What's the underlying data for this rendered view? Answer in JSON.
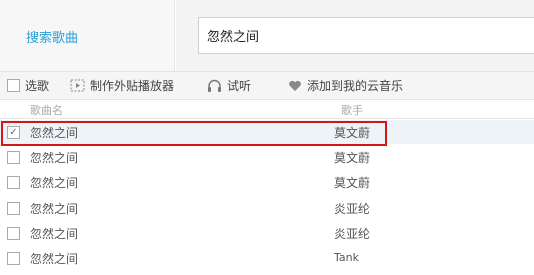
{
  "nav": {
    "search_songs": "搜索歌曲"
  },
  "search": {
    "value": "忽然之间"
  },
  "toolbar": {
    "select_all": "选歌",
    "make_player": "制作外贴播放器",
    "listen": "试听",
    "add_cloud": "添加到我的云音乐"
  },
  "columns": {
    "song": "歌曲名",
    "artist": "歌手"
  },
  "rows": [
    {
      "song": "忽然之间",
      "artist": "莫文蔚",
      "checked": true
    },
    {
      "song": "忽然之间",
      "artist": "莫文蔚",
      "checked": false
    },
    {
      "song": "忽然之间",
      "artist": "莫文蔚",
      "checked": false
    },
    {
      "song": "忽然之间",
      "artist": "炎亚纶",
      "checked": false
    },
    {
      "song": "忽然之间",
      "artist": "炎亚纶",
      "checked": false
    },
    {
      "song": "忽然之间",
      "artist": "Tank",
      "checked": false
    }
  ],
  "colors": {
    "link": "#2a9fd8",
    "highlight_border": "#d01818",
    "selected_row_bg": "#eef3f8"
  },
  "icons": [
    "checkbox-icon",
    "player-embed-icon",
    "headphones-icon",
    "heart-icon"
  ]
}
